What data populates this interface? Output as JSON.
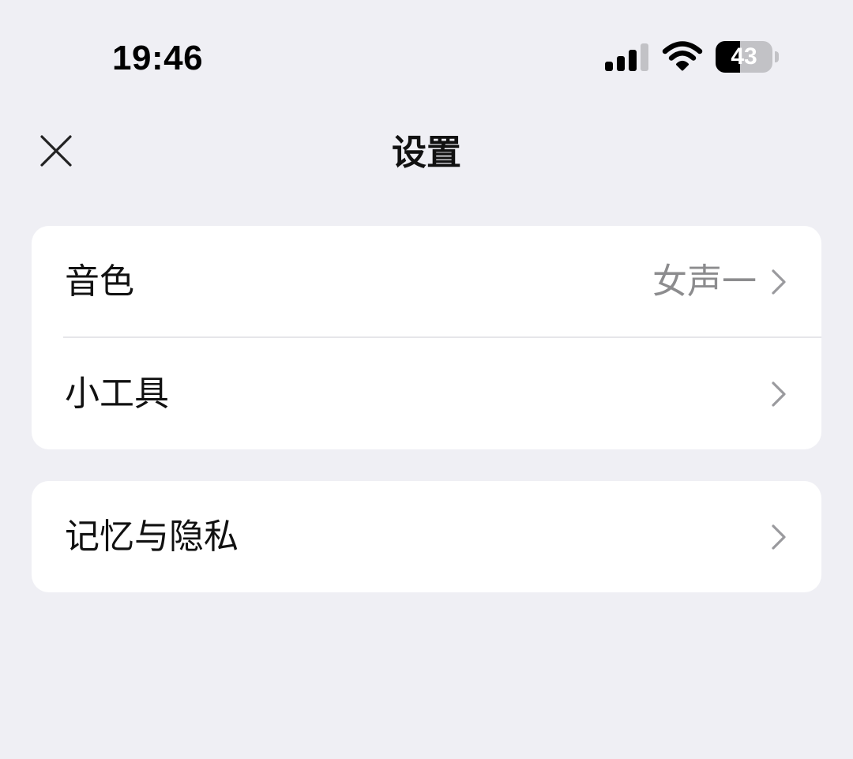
{
  "status_bar": {
    "time": "19:46",
    "battery_level": "43",
    "battery_fraction": 0.43,
    "icons": [
      "signal-icon",
      "wifi-icon",
      "battery-icon"
    ]
  },
  "nav": {
    "title": "设置",
    "close_icon": "close-icon"
  },
  "sections": [
    {
      "rows": [
        {
          "label": "音色",
          "value": "女声一",
          "icon": "chevron-right-icon"
        },
        {
          "label": "小工具",
          "value": "",
          "icon": "chevron-right-icon"
        }
      ]
    },
    {
      "rows": [
        {
          "label": "记忆与隐私",
          "value": "",
          "icon": "chevron-right-icon"
        }
      ]
    }
  ],
  "colors": {
    "background": "#efeff4",
    "card": "#ffffff",
    "text": "#111111",
    "secondary_text": "#8c8c8e",
    "chevron": "#9a9a9e"
  }
}
